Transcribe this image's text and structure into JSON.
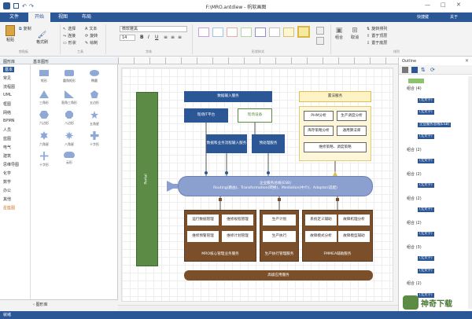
{
  "window": {
    "title": "F:\\MRO.antdiew - 帆软画图",
    "user": "快捷键",
    "about": "关于"
  },
  "tabs": [
    {
      "label": "文件"
    },
    {
      "label": "开始"
    },
    {
      "label": "视图"
    },
    {
      "label": "布局"
    }
  ],
  "ribbon": {
    "paste": "粘贴",
    "copy": "复制",
    "format_painter": "格式刷",
    "clipboard_label": "剪贴板",
    "select": "选择",
    "connector": "连接",
    "shape": "形状",
    "text": "文本",
    "rotate": "旋转",
    "draw": "绘制",
    "tools_label": "工具",
    "font_name": "微软雅黑",
    "font_size": "14",
    "bold": "B",
    "italic": "I",
    "underline": "U",
    "font_label": "字体",
    "format_label": "形状样式",
    "arrange_label": "排列",
    "group": "组合",
    "ungroup": "取消",
    "arrange1": "旋转排列",
    "arrange2": "置于顶层",
    "arrange3": "置于底层"
  },
  "left_panel": {
    "tab1": "图形库",
    "tab2": "基本图形",
    "categories": [
      "基本",
      "常见",
      "流程图",
      "UML",
      "框图",
      "网络",
      "BPMN",
      "人员",
      "蓝图",
      "电气",
      "建筑",
      "思维导图",
      "化学",
      "数学",
      "办公",
      "其他",
      "星座图"
    ],
    "shapes": [
      {
        "label": "矩形"
      },
      {
        "label": "圆角矩形"
      },
      {
        "label": "椭圆"
      },
      {
        "label": "三角形"
      },
      {
        "label": "直角三角形"
      },
      {
        "label": "五边形"
      },
      {
        "label": "六边形"
      },
      {
        "label": "八边形"
      },
      {
        "label": "五角星"
      },
      {
        "label": "六角星"
      },
      {
        "label": "八角星"
      },
      {
        "label": "十字形"
      },
      {
        "label": "十字形"
      },
      {
        "label": "云形"
      }
    ],
    "footer": "图形库"
  },
  "outline": {
    "title": "Outline",
    "items": [
      {
        "label": "组合 (4)",
        "tag": ""
      },
      {
        "label": "",
        "tag": "(无文字)"
      },
      {
        "label": "",
        "tag": "(无文字)"
      },
      {
        "label": "",
        "tag": "企业服务总线(ESB)"
      },
      {
        "label": "",
        "tag": "(无文字)"
      },
      {
        "label": "组合 (2)",
        "tag": ""
      },
      {
        "label": "",
        "tag": "(无文字)"
      },
      {
        "label": "组合 (2)",
        "tag": ""
      },
      {
        "label": "",
        "tag": "(无文字)"
      },
      {
        "label": "组合 (2)",
        "tag": ""
      },
      {
        "label": "",
        "tag": "(无文字)"
      },
      {
        "label": "组合 (2)",
        "tag": ""
      },
      {
        "label": "",
        "tag": "(无文字)"
      },
      {
        "label": "组合 (3)",
        "tag": ""
      },
      {
        "label": "",
        "tag": "(无文字)"
      },
      {
        "label": "",
        "tag": "(无文字)"
      },
      {
        "label": "组合 (2)",
        "tag": ""
      },
      {
        "label": "",
        "tag": "(无文字)"
      }
    ]
  },
  "diagram": {
    "portal": "Portal",
    "data_input": "数据输入服务",
    "xml_dev": "现场IT平台",
    "field_device": "现场设备",
    "data_capture": "数据和业务流程输入服务",
    "preprocess": "预处理服务",
    "rule_service": "置法服务",
    "phm": "PHM分析",
    "prod_mgmt": "生产调度分析",
    "inventory": "库存策略分析",
    "general": "通用算法库",
    "maintenance": "维修策略、调度策略",
    "esb_title": "企业服务总线(ESB)",
    "esb_sub": "Routing(路由)、Transformation(转换)、Mediation(中介)、Adaptor(适配)",
    "mro1": "运行数据管理",
    "mro2": "维修规程管理",
    "mro3": "维修预警管理",
    "mro4": "维修计划管理",
    "mro_label": "MRO核心管理业务服务",
    "prod1": "生产计划",
    "prod2": "生产执行",
    "prod_label": "生产执行管理服务",
    "fmea1": "系统定义辅助",
    "fmea2": "故障机理分析",
    "fmea3": "故障模式分析",
    "fmea4": "故障模型辅助",
    "fmea_label": "FMMEA辅助服务",
    "advanced": "高级应用服务"
  },
  "status": "就绪",
  "watermark": "神奇下载",
  "colors": {
    "accent": "#2b5797",
    "olive": "#5b8b45",
    "brown": "#7a4f2a",
    "esb": "#8ca0cf"
  }
}
